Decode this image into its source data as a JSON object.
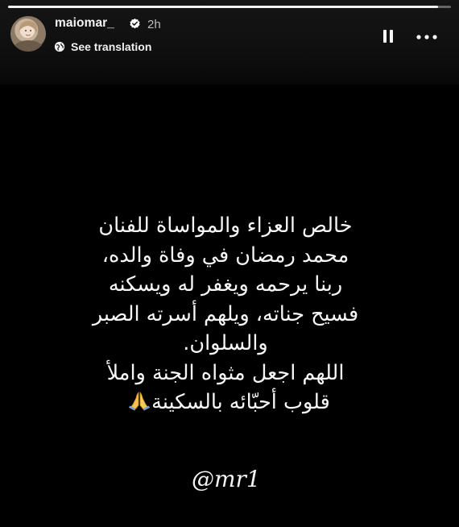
{
  "story": {
    "progress_fraction": 0.97,
    "author": {
      "username": "maiomar_",
      "verified": true,
      "time_ago": "2h"
    },
    "translation_label": "See translation",
    "controls": {
      "pause_icon": "pause-icon",
      "more_icon": "more-horizontal-icon"
    },
    "text_lines": [
      "خالص العزاء والمواساة للفنان",
      "محمد رمضان في وفاة والده،",
      "ربنا يرحمه ويغفر له ويسكنه",
      "فسيح جناته، ويلهم أسرته الصبر",
      "والسلوان.",
      "اللهم اجعل مثواه الجنة واملأ",
      "قلوب أحبّائه بالسكينة"
    ],
    "closing_emoji": "folded-hands-emoji",
    "mention": "@mr1",
    "colors": {
      "background": "#000000",
      "text": "#f7f7f7",
      "verified_badge": "#ffffff"
    }
  }
}
